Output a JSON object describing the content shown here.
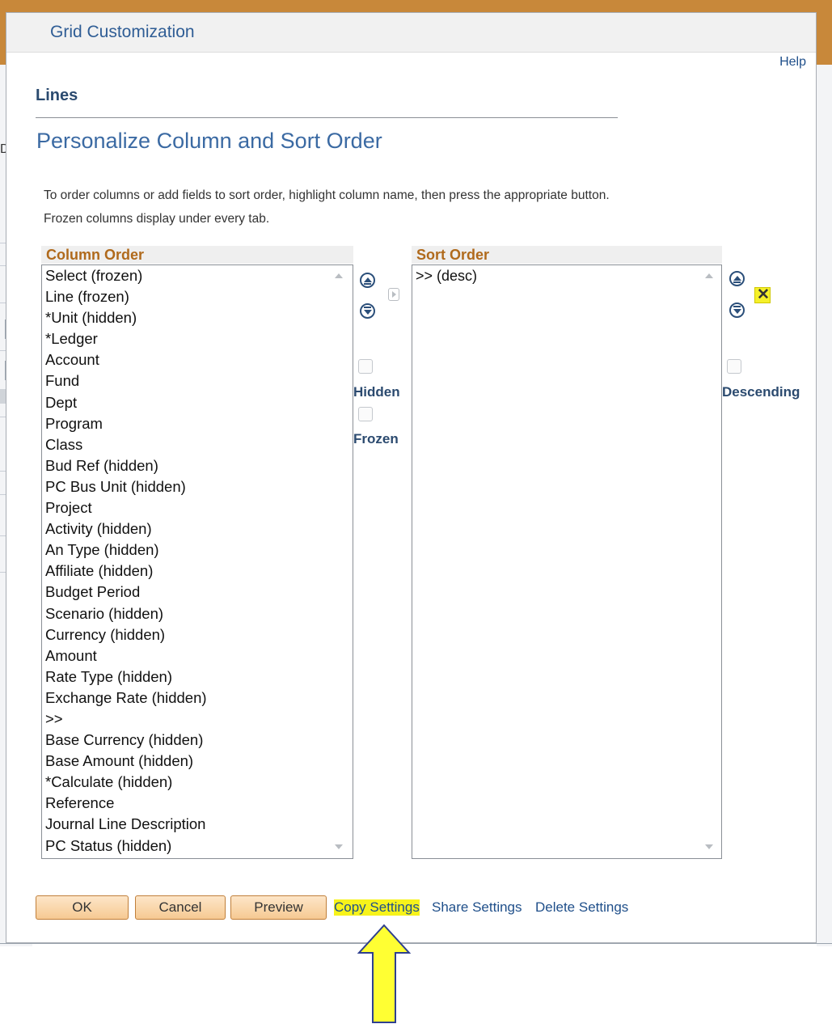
{
  "background": {
    "partial_label": "Date"
  },
  "dialog": {
    "title": "Grid Customization",
    "help_label": "Help",
    "section_title": "Lines",
    "heading": "Personalize Column and Sort Order",
    "instructions": [
      "To order columns or add fields to sort order, highlight column name, then press the appropriate button.",
      "Frozen columns display under every tab."
    ]
  },
  "column_order": {
    "header": "Column Order",
    "items": [
      "Select (frozen)",
      "Line (frozen)",
      "*Unit (hidden)",
      "*Ledger",
      "Account",
      "Fund",
      "Dept",
      "Program",
      "Class",
      "Bud Ref (hidden)",
      "PC Bus Unit (hidden)",
      "Project",
      "Activity (hidden)",
      "An Type (hidden)",
      "Affiliate (hidden)",
      "Budget Period",
      "Scenario (hidden)",
      "Currency (hidden)",
      "Amount",
      "Rate Type (hidden)",
      "Exchange Rate (hidden)",
      ">>",
      "Base Currency (hidden)",
      "Base Amount (hidden)",
      "*Calculate (hidden)",
      "Reference",
      "Journal Line Description",
      "PC Status (hidden)"
    ]
  },
  "column_controls": {
    "move_up_icon": "circle-up-icon",
    "move_down_icon": "circle-down-icon",
    "add_to_sort_icon": "arrow-right-icon",
    "hidden_label": "Hidden",
    "frozen_label": "Frozen",
    "hidden_checked": false,
    "frozen_checked": false
  },
  "sort_order": {
    "header": "Sort Order",
    "items": [
      ">> (desc)"
    ]
  },
  "sort_controls": {
    "descending_label": "Descending",
    "descending_checked": false,
    "delete_icon": "x-icon"
  },
  "buttons": {
    "ok": "OK",
    "cancel": "Cancel",
    "preview": "Preview"
  },
  "links": {
    "copy": "Copy Settings",
    "share": "Share Settings",
    "delete": "Delete Settings"
  },
  "colors": {
    "header_accent": "#c8883a",
    "link": "#1f4f8a",
    "highlight": "#f7f31b",
    "arrow_fill": "#ffff33",
    "arrow_stroke": "#2e3f8f"
  }
}
